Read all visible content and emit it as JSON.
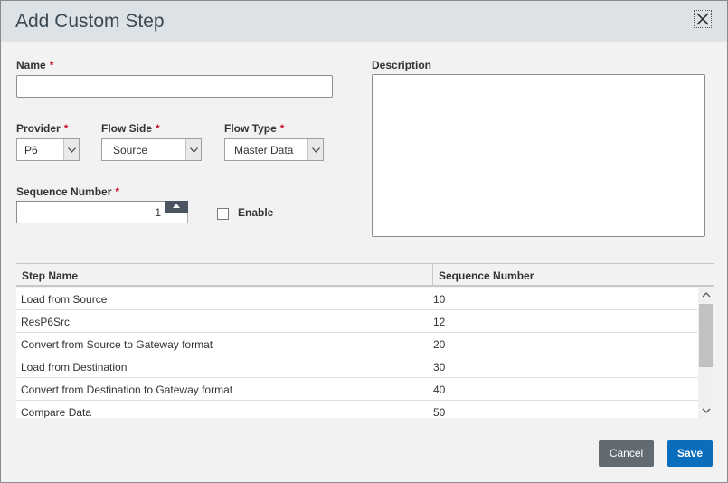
{
  "dialog": {
    "title": "Add Custom Step",
    "close_icon": "close-icon"
  },
  "form": {
    "required_marker": "*",
    "name": {
      "label": "Name",
      "value": ""
    },
    "description": {
      "label": "Description",
      "value": ""
    },
    "provider": {
      "label": "Provider",
      "value": "P6"
    },
    "flow_side": {
      "label": "Flow Side",
      "value": "Source"
    },
    "flow_type": {
      "label": "Flow Type",
      "value": "Master Data"
    },
    "sequence_number": {
      "label": "Sequence Number",
      "value": "1"
    },
    "enable": {
      "label": "Enable",
      "checked": false
    }
  },
  "table": {
    "columns": [
      "Step Name",
      "Sequence Number"
    ],
    "rows": [
      {
        "step_name": "Load from Source",
        "sequence": "10"
      },
      {
        "step_name": "ResP6Src",
        "sequence": "12"
      },
      {
        "step_name": "Convert from Source to Gateway format",
        "sequence": "20"
      },
      {
        "step_name": "Load from Destination",
        "sequence": "30"
      },
      {
        "step_name": "Convert from Destination to Gateway format",
        "sequence": "40"
      },
      {
        "step_name": "Compare Data",
        "sequence": "50"
      }
    ]
  },
  "buttons": {
    "cancel": "Cancel",
    "save": "Save"
  },
  "colors": {
    "title_bar": "#dde2e6",
    "required": "#c8102e",
    "save_button": "#0a6ebd",
    "cancel_button": "#626a72"
  }
}
